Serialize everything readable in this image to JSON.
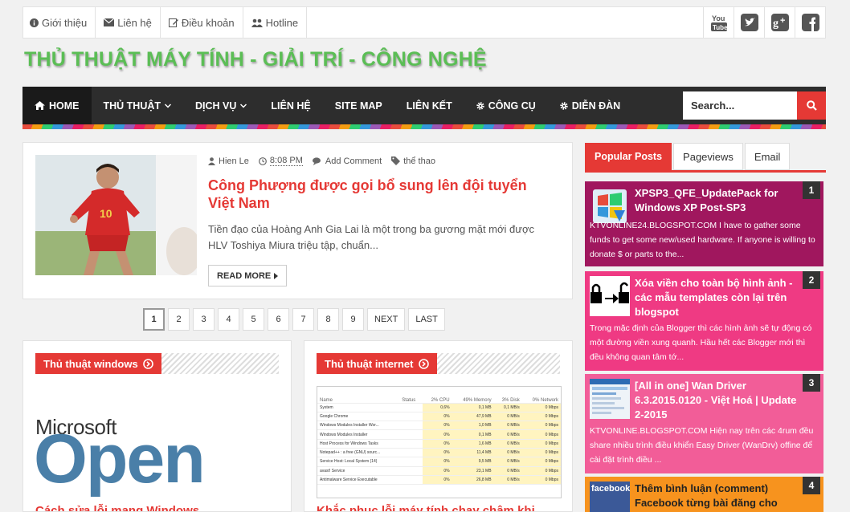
{
  "topbar": {
    "links": [
      {
        "icon": "info-icon",
        "label": "Giới thiệu"
      },
      {
        "icon": "envelope-icon",
        "label": "Liên hệ"
      },
      {
        "icon": "edit-icon",
        "label": "Điều khoản"
      },
      {
        "icon": "users-icon",
        "label": "Hotline"
      }
    ],
    "social": [
      "youtube-icon",
      "twitter-icon",
      "google-plus-icon",
      "facebook-icon"
    ]
  },
  "site": {
    "title": "THỦ THUẬT MÁY TÍNH - GIẢI TRÍ - CÔNG NGHỆ"
  },
  "nav": {
    "items": [
      {
        "label": "HOME",
        "icon": "home-icon",
        "active": true
      },
      {
        "label": "THỦ THUẬT",
        "dropdown": true
      },
      {
        "label": "DỊCH VỤ",
        "dropdown": true
      },
      {
        "label": "LIÊN HỆ"
      },
      {
        "label": "SITE MAP"
      },
      {
        "label": "LIÊN KẾT"
      },
      {
        "label": "CÔNG CỤ",
        "icon": "gear-icon"
      },
      {
        "label": "DIỄN ĐÀN",
        "icon": "gear-icon"
      }
    ],
    "search_placeholder": "Search..."
  },
  "post": {
    "author": "Hien Le",
    "time": "8:08 PM",
    "comment": "Add Comment",
    "tag": "thể thao",
    "title": "Công Phượng được gọi bổ sung lên đội tuyển Việt Nam",
    "excerpt": "Tiền đạo của Hoàng Anh Gia Lai là một trong ba gương mặt mới được HLV Toshiya Miura triệu tập, chuẩn...",
    "read_more": "READ MORE",
    "jersey_number": "10"
  },
  "pagination": [
    "1",
    "2",
    "3",
    "4",
    "5",
    "6",
    "7",
    "8",
    "9",
    "NEXT",
    "LAST"
  ],
  "categories": [
    {
      "label": "Thủ thuật windows",
      "image_brand": "Microsoft",
      "image_word": "Open",
      "caption": "Cách sửa lỗi mạng Windows..."
    },
    {
      "label": "Thủ thuật internet",
      "caption": "Khắc phục lỗi máy tính chạy chậm khi..."
    }
  ],
  "taskmgr": {
    "headers": [
      "Name",
      "Status",
      "2%\nCPU",
      "49%\nMemory",
      "3%\nDisk",
      "0%\nNetwork"
    ],
    "rows": [
      [
        "System",
        "",
        "0,6%",
        "0,1 MB",
        "0,1 MB/s",
        "0 Mbps"
      ],
      [
        "Google Chrome",
        "",
        "0%",
        "47,9 MB",
        "0 MB/s",
        "0 Mbps"
      ],
      [
        "Windows Modules Installer Wor...",
        "",
        "0%",
        "1,0 MB",
        "0 MB/s",
        "0 Mbps"
      ],
      [
        "Windows Modules Installer",
        "",
        "0%",
        "0,1 MB",
        "0 MB/s",
        "0 Mbps"
      ],
      [
        "Host Process for Windows Tasks",
        "",
        "0%",
        "1,6 MB",
        "0 MB/s",
        "0 Mbps"
      ],
      [
        "Notepad++ : a free (GNU) sourc...",
        "",
        "0%",
        "11,4 MB",
        "0 MB/s",
        "0 Mbps"
      ],
      [
        "Service Host: Local System (14)",
        "",
        "0%",
        "9,5 MB",
        "0 MB/s",
        "0 Mbps"
      ],
      [
        "avast! Service",
        "",
        "0%",
        "23,1 MB",
        "0 MB/s",
        "0 Mbps"
      ],
      [
        "Antimalware Service Executable",
        "",
        "0%",
        "26,8 MB",
        "0 MB/s",
        "0 Mbps"
      ]
    ]
  },
  "sidebar": {
    "tabs": [
      "Popular Posts",
      "Pageviews",
      "Email"
    ],
    "posts": [
      {
        "num": "1",
        "title": "XPSP3_QFE_UpdatePack for Windows XP Post-SP3",
        "desc": "KTVONLINE24.BLOGSPOT.COM I have to gather some funds to get some new/used hardware. If anyone is willing to donate $ or parts to the...",
        "color": "#a0175e"
      },
      {
        "num": "2",
        "title": "Xóa viền cho toàn bộ hình ảnh - các mẫu templates còn lại trên blogspot",
        "desc": "Trong mặc định của Blogger thì các hình ảnh sẽ tự động có một đường viền xung quanh. Hầu hết các Blogger mới thì đều không quan tâm tớ...",
        "color": "#ef3a83"
      },
      {
        "num": "3",
        "title": "[All in one] Wan Driver 6.3.2015.0120 - Việt Hoá | Update 2-2015",
        "desc": "KTVONLINE.BLOGSPOT.COM Hiện nay trên các 4rum đều share nhiều trình điều khiển Easy Driver (WanDrv) offine để cài đặt trình điều ...",
        "color": "#f25d98"
      },
      {
        "num": "4",
        "title": "Thêm bình luận (comment) Facebook từng bài đăng cho",
        "desc": "",
        "color": "#f7931e",
        "img_label": "facebook"
      }
    ]
  }
}
